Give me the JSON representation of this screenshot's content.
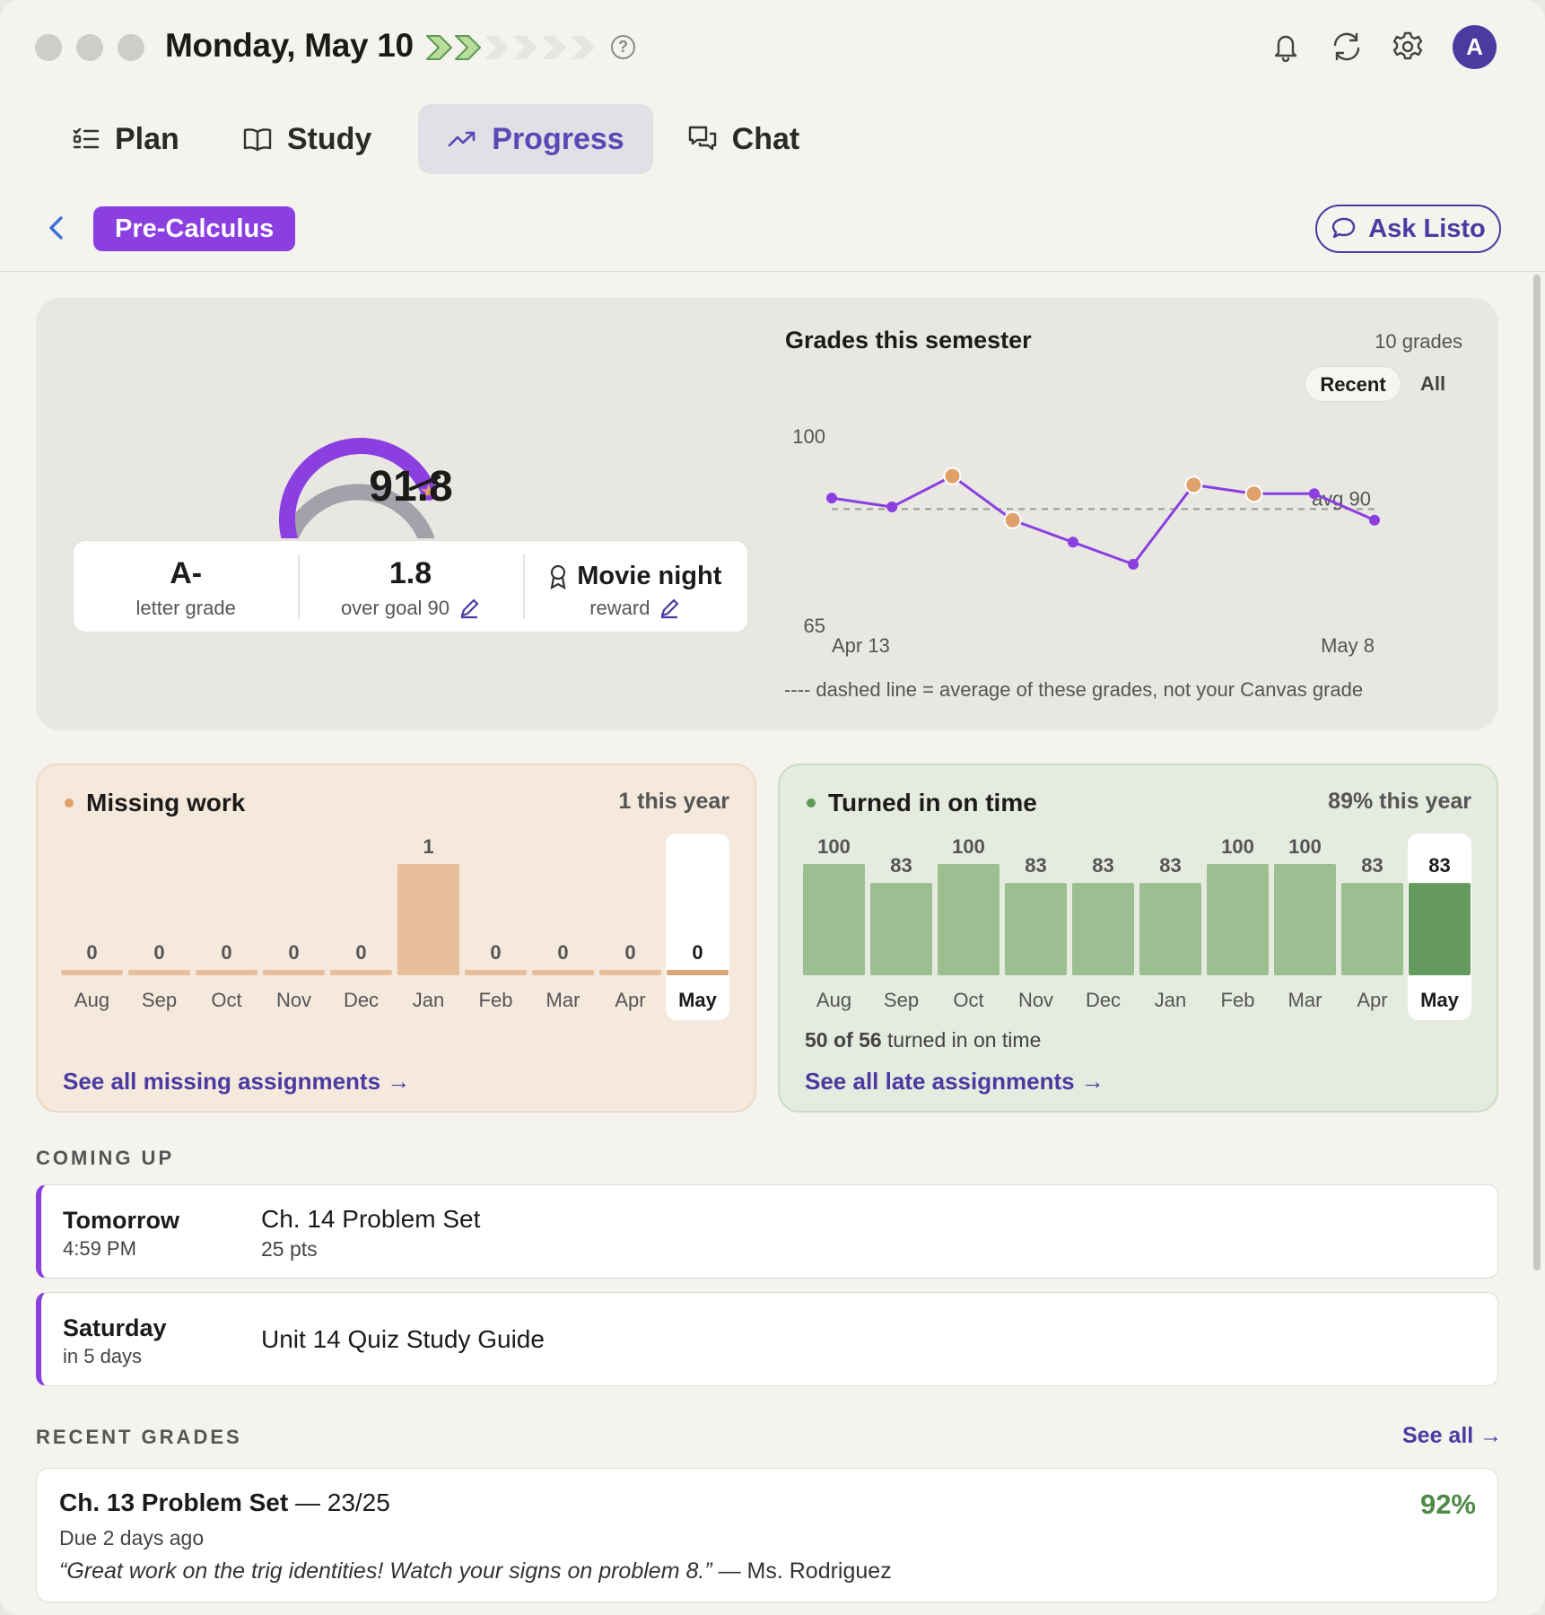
{
  "header": {
    "date": "Monday, May 10",
    "streak": {
      "filled": 2,
      "total": 6
    },
    "help_glyph": "?",
    "icons": [
      "bell-icon",
      "refresh-icon",
      "gear-icon"
    ],
    "avatar_initial": "A"
  },
  "tabs": [
    {
      "label": "Plan",
      "icon": "list-icon",
      "active": false
    },
    {
      "label": "Study",
      "icon": "book-icon",
      "active": false
    },
    {
      "label": "Progress",
      "icon": "trend-icon",
      "active": true
    },
    {
      "label": "Chat",
      "icon": "chat-icon",
      "active": false
    }
  ],
  "subject": "Pre-Calculus",
  "ask_button": "Ask Listo",
  "summary": {
    "score": "91.8",
    "score_value": 91.8,
    "goal_value": 90,
    "letter": "A-",
    "letter_label": "letter grade",
    "over_goal": "1.8",
    "over_goal_label": "over goal 90",
    "reward": "Movie night",
    "reward_label": "reward"
  },
  "grades_chart": {
    "title": "Grades this semester",
    "count": "10 grades",
    "toggle": [
      "Recent",
      "All"
    ],
    "active_toggle": "Recent",
    "avg_label": "avg 90",
    "note": "---- dashed line = average of these grades, not your Canvas grade",
    "colors": {
      "line": "#8b3fe0",
      "highlight": "#e0a06a"
    }
  },
  "missing_work": {
    "title": "Missing work",
    "summary": "1 this year",
    "link": "See all missing assignments →",
    "color": "#e8bf9c"
  },
  "on_time": {
    "title": "Turned in on time",
    "summary": "89% this year",
    "subtext_bold": "50 of 56",
    "subtext": " turned in on time",
    "link": "See all late assignments →",
    "color": "#9cbf91",
    "current_color": "#659a5e"
  },
  "chart_data": [
    {
      "type": "line",
      "title": "Grades this semester",
      "x_labels": [
        "Apr 13",
        "May 8"
      ],
      "y": [
        90,
        88,
        95,
        85,
        80,
        75,
        93,
        91,
        91,
        85
      ],
      "highlighted_points": [
        2,
        3,
        6,
        7
      ],
      "ylim": [
        65,
        100
      ],
      "reference_line": {
        "label": "avg 90",
        "value": 87.5,
        "style": "dashed"
      }
    },
    {
      "type": "bar",
      "title": "Missing work",
      "categories": [
        "Aug",
        "Sep",
        "Oct",
        "Nov",
        "Dec",
        "Jan",
        "Feb",
        "Mar",
        "Apr",
        "May"
      ],
      "values": [
        0,
        0,
        0,
        0,
        0,
        1,
        0,
        0,
        0,
        0
      ],
      "highlighted_category": "May",
      "ylim": [
        0,
        1
      ]
    },
    {
      "type": "bar",
      "title": "Turned in on time",
      "categories": [
        "Aug",
        "Sep",
        "Oct",
        "Nov",
        "Dec",
        "Jan",
        "Feb",
        "Mar",
        "Apr",
        "May"
      ],
      "values": [
        100,
        83,
        100,
        83,
        83,
        83,
        100,
        100,
        83,
        83
      ],
      "highlighted_category": "May",
      "ylim": [
        0,
        100
      ]
    }
  ],
  "coming_up": {
    "heading": "COMING UP",
    "items": [
      {
        "day": "Tomorrow",
        "time": "4:59 PM",
        "name": "Ch. 14 Problem Set",
        "points": "25 pts"
      },
      {
        "day": "Saturday",
        "time": "in 5 days",
        "name": "Unit 14 Quiz Study Guide",
        "points": ""
      }
    ]
  },
  "recent_grades": {
    "heading": "RECENT GRADES",
    "see_all": "See all →",
    "items": [
      {
        "name": "Ch. 13 Problem Set",
        "score": "— 23/25",
        "due": "Due 2 days ago",
        "quote": "“Great work on the trig identities! Watch your signs on problem 8.”",
        "author": " — Ms. Rodriguez",
        "percent": "92%"
      }
    ]
  }
}
